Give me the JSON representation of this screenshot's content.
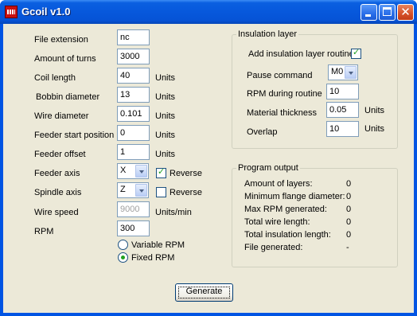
{
  "window": {
    "title": "Gcoil v1.0"
  },
  "form": {
    "file_extension": {
      "label": "File extension",
      "value": "nc"
    },
    "amount_of_turns": {
      "label": "Amount of turns",
      "value": "3000"
    },
    "coil_length": {
      "label": "Coil length",
      "value": "40",
      "unit": "Units"
    },
    "bobbin_diameter": {
      "label": "Bobbin diameter",
      "value": "13",
      "unit": "Units"
    },
    "wire_diameter": {
      "label": "Wire diameter",
      "value": "0.101",
      "unit": "Units"
    },
    "feeder_start_position": {
      "label": "Feeder start position",
      "value": "0",
      "unit": "Units"
    },
    "feeder_offset": {
      "label": "Feeder offset",
      "value": "1",
      "unit": "Units"
    },
    "feeder_axis": {
      "label": "Feeder axis",
      "value": "X",
      "reverse_label": "Reverse",
      "reverse_checked": true
    },
    "spindle_axis": {
      "label": "Spindle axis",
      "value": "Z",
      "reverse_label": "Reverse",
      "reverse_checked": false
    },
    "wire_speed": {
      "label": "Wire speed",
      "value": "9000",
      "unit": "Units/min"
    },
    "rpm": {
      "label": "RPM",
      "value": "300"
    },
    "rpm_mode": {
      "variable_label": "Variable RPM",
      "fixed_label": "Fixed RPM",
      "selected": "fixed"
    }
  },
  "insulation": {
    "title": "Insulation layer",
    "add_routine_label": "Add insulation layer routine",
    "add_routine_checked": true,
    "pause_command": {
      "label": "Pause command",
      "value": "M0"
    },
    "rpm_during_routine": {
      "label": "RPM during routine",
      "value": "10"
    },
    "material_thickness": {
      "label": "Material thickness",
      "value": "0.05",
      "unit": "Units"
    },
    "overlap": {
      "label": "Overlap",
      "value": "10",
      "unit": "Units"
    }
  },
  "output": {
    "title": "Program output",
    "rows": [
      {
        "label": "Amount of layers:",
        "value": "0"
      },
      {
        "label": "Minimum flange diameter:",
        "value": "0"
      },
      {
        "label": "Max RPM generated:",
        "value": "0"
      },
      {
        "label": "Total wire length:",
        "value": "0"
      },
      {
        "label": "Total insulation length:",
        "value": "0"
      },
      {
        "label": "File generated:",
        "value": "-"
      }
    ]
  },
  "actions": {
    "generate_label": "Generate"
  },
  "colors": {
    "titlebar": "#0758dc",
    "client": "#ece9d8",
    "close_button": "#d5502a",
    "checkmark": "#21a121"
  }
}
